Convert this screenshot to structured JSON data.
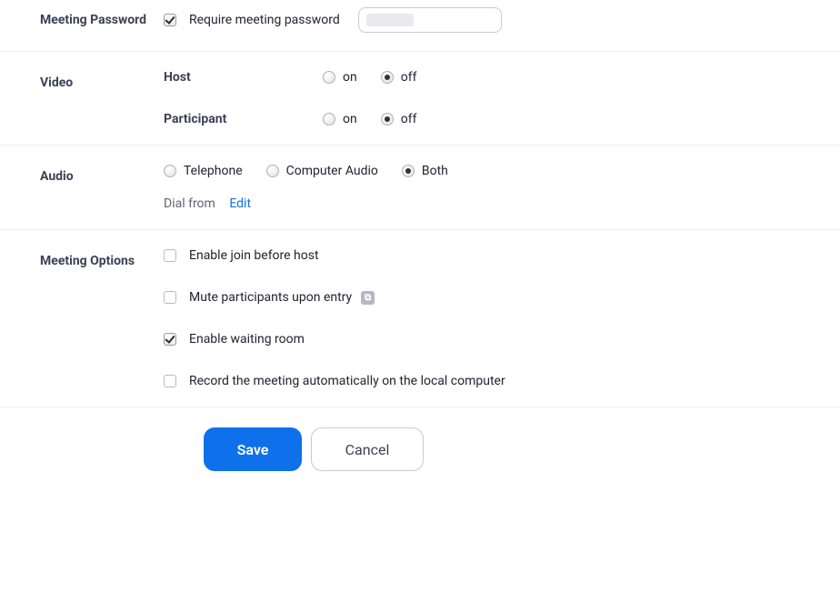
{
  "password": {
    "label": "Meeting Password",
    "require_label": "Require meeting password",
    "checked": true,
    "value": ""
  },
  "video": {
    "label": "Video",
    "host": {
      "label": "Host",
      "on": "on",
      "off": "off",
      "selected": "off"
    },
    "participant": {
      "label": "Participant",
      "on": "on",
      "off": "off",
      "selected": "off"
    }
  },
  "audio": {
    "label": "Audio",
    "options": {
      "telephone": "Telephone",
      "computer": "Computer Audio",
      "both": "Both"
    },
    "selected": "both",
    "dial_from_label": "Dial from",
    "edit_label": "Edit"
  },
  "options": {
    "label": "Meeting Options",
    "join_before_host": {
      "label": "Enable join before host",
      "checked": false
    },
    "mute_on_entry": {
      "label": "Mute participants upon entry",
      "checked": false
    },
    "waiting_room": {
      "label": "Enable waiting room",
      "checked": true
    },
    "record_auto": {
      "label": "Record the meeting automatically on the local computer",
      "checked": false
    }
  },
  "actions": {
    "save": "Save",
    "cancel": "Cancel"
  }
}
